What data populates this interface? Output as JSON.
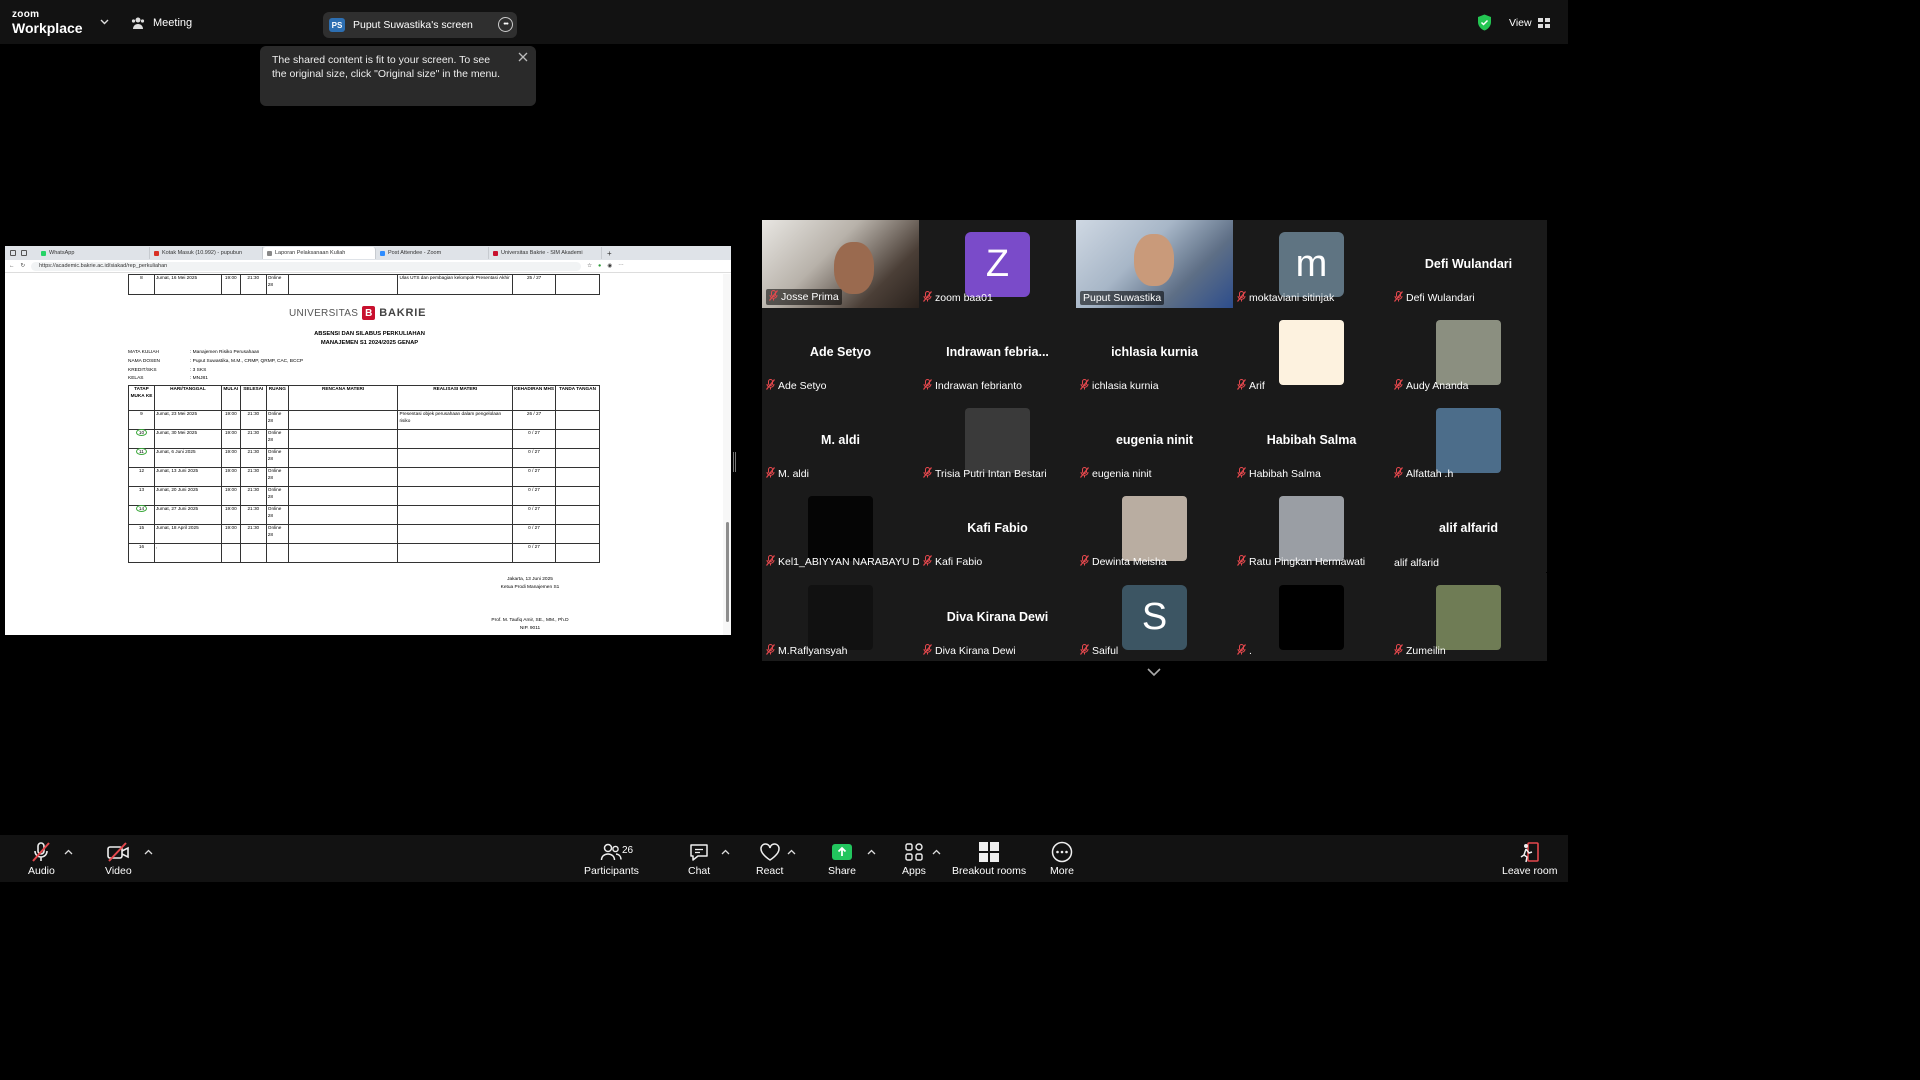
{
  "app": {
    "brand_line1": "zoom",
    "brand_line2": "Workplace",
    "meeting_label": "Meeting"
  },
  "share_pill": {
    "badge": "PS",
    "title": "Puput Suwastika's screen"
  },
  "view_label": "View",
  "tooltip": {
    "text": "The shared content is fit to your screen. To see the original size, click \"Original size\" in the menu."
  },
  "browser": {
    "tabs": [
      {
        "label": "WhatsApp",
        "color": "#25d366"
      },
      {
        "label": "Kotak Masuk (10.992) - pupubun",
        "color": "#d93025"
      },
      {
        "label": "Laporan Pelaksanaan Kuliah",
        "color": "#888888"
      },
      {
        "label": "Post Attendee - Zoom",
        "color": "#2d8cff"
      },
      {
        "label": "Universitas Bakrie - SIM Akademi",
        "color": "#c8102e"
      }
    ],
    "url": "https://academic.bakrie.ac.id/siakad/rep_perkuliahan"
  },
  "document": {
    "uni_left": "UNIVERSITAS",
    "uni_mark": "B",
    "uni_right": "BAKRIE",
    "title1": "ABSENSI DAN SILABUS PERKULIAHAN",
    "title2": "MANAJEMEN S1 2024/2025 GENAP",
    "meta": [
      {
        "k": "MATA KULIAH",
        "v": ": Manajemen Risiko Perusahaan"
      },
      {
        "k": "NAMA DOSEN",
        "v": ": Puput Suwastika, M.M., CRMP, QRMP, CAC, BCCP"
      },
      {
        "k": "KREDIT/SKS",
        "v": ": 3 SKS"
      },
      {
        "k": "KELAS",
        "v": ": MNJ81"
      }
    ],
    "prev_row": {
      "no": "8",
      "date": "Jumat, 16 Mei 2025",
      "start": "19:00",
      "end": "21:30",
      "room": "Online 28",
      "realisasi": "Ulas UTS dan pembagian kelompok Presentasi Akhir",
      "att": "25 / 27"
    },
    "headers": [
      "TATAP MUKA KE",
      "HARI/TANGGAL",
      "MULAI",
      "SELESAI",
      "RUANG",
      "RENCANA MATERI",
      "REALISASI MATERI",
      "KEHADIRAN MHS",
      "TANDA TANGAN"
    ],
    "rows": [
      {
        "no": "9",
        "date": "Jumat, 23 Mei 2025",
        "start": "19:00",
        "end": "21:30",
        "room": "Online 28",
        "realisasi": "Presentasi objek perusahaan dalam pengelolaan risiko",
        "att": "26 / 27"
      },
      {
        "no": "10",
        "date": "Jumat, 30 Mei 2025",
        "start": "19:00",
        "end": "21:30",
        "room": "Online 28",
        "realisasi": "",
        "att": "0 / 27"
      },
      {
        "no": "11",
        "date": "Jumat, 6 Juni 2025",
        "start": "19:00",
        "end": "21:30",
        "room": "Online 28",
        "realisasi": "",
        "att": "0 / 27"
      },
      {
        "no": "12",
        "date": "Jumat, 13 Juni 2025",
        "start": "19:00",
        "end": "21:30",
        "room": "Online 28",
        "realisasi": "",
        "att": "0 / 27"
      },
      {
        "no": "13",
        "date": "Jumat, 20 Juni 2025",
        "start": "19:00",
        "end": "21:30",
        "room": "Online 28",
        "realisasi": "",
        "att": "0 / 27"
      },
      {
        "no": "14",
        "date": "Jumat, 27 Juni 2025",
        "start": "19:00",
        "end": "21:30",
        "room": "Online 28",
        "realisasi": "",
        "att": "0 / 27"
      },
      {
        "no": "15",
        "date": "Jumat, 18 April 2025",
        "start": "19:00",
        "end": "21:30",
        "room": "Online 28",
        "realisasi": "",
        "att": "0 / 27"
      },
      {
        "no": "16",
        "date": ",",
        "start": "",
        "end": "",
        "room": "",
        "realisasi": "",
        "att": "0 / 27"
      }
    ],
    "sign_place": "Jakarta, 13 Juni 2025",
    "sign_role": "Ketua Prodi Manajemen S1",
    "sign_name": "Prof. M. Taufiq Amir, SE., MM., Ph.D",
    "sign_nip": "NIP. 9011"
  },
  "participants": [
    {
      "name": "Josse Prima",
      "type": "video",
      "muted": true
    },
    {
      "name": "zoom baa01",
      "type": "avatar",
      "letter": "Z",
      "color": "#7a4bc9",
      "muted": true
    },
    {
      "name": "Puput Suwastika",
      "type": "video",
      "muted": false,
      "speaking": true
    },
    {
      "name": "moktaviani sitinjak",
      "type": "avatar",
      "letter": "m",
      "color": "#5f7482",
      "muted": true
    },
    {
      "name": "Defi Wulandari",
      "type": "text",
      "muted": true
    },
    {
      "name": "Ade Setyo",
      "type": "text",
      "muted": true
    },
    {
      "name": "Indrawan febrianto",
      "display": "Indrawan  febria...",
      "type": "text",
      "muted": true
    },
    {
      "name": "ichlasia kurnia",
      "type": "text",
      "muted": true
    },
    {
      "name": "Arif",
      "type": "thumb",
      "color": "#fdf2df",
      "muted": true
    },
    {
      "name": "Audy Ananda",
      "type": "thumb",
      "color": "#8b8f80",
      "muted": true
    },
    {
      "name": "M. aldi",
      "type": "text",
      "muted": true
    },
    {
      "name": "Trisia Putri Intan Bestari",
      "type": "thumb",
      "color": "#3a3a3a",
      "muted": true
    },
    {
      "name": "eugenia ninit",
      "type": "text",
      "muted": true
    },
    {
      "name": "Habibah Salma",
      "type": "text",
      "muted": true
    },
    {
      "name": "Alfattah .h",
      "type": "thumb",
      "color": "#4c6d8a",
      "muted": true
    },
    {
      "name": "Kel1_ABIYYAN NARABAYU D",
      "type": "thumb",
      "color": "#050505",
      "muted": true
    },
    {
      "name": "Kafi Fabio",
      "type": "text",
      "muted": true
    },
    {
      "name": "Dewinta Meisha",
      "type": "thumb",
      "color": "#b9ada1",
      "muted": true
    },
    {
      "name": "Ratu Pingkan Hermawati",
      "type": "thumb",
      "color": "#9a9ea4",
      "muted": true
    },
    {
      "name": "alif alfarid",
      "type": "text",
      "muted": false
    },
    {
      "name": "M.Raflyansyah",
      "type": "thumb",
      "color": "#111111",
      "muted": true
    },
    {
      "name": "Diva Kirana Dewi",
      "type": "text",
      "muted": true
    },
    {
      "name": "Saiful",
      "type": "avatar",
      "letter": "S",
      "color": "#3c5563",
      "muted": true
    },
    {
      "name": ".",
      "type": "thumb",
      "color": "#000000",
      "muted": true
    },
    {
      "name": "Zumeilin",
      "type": "thumb",
      "color": "#6f7c55",
      "muted": true
    }
  ],
  "toolbar": {
    "audio": "Audio",
    "video": "Video",
    "participants": "Participants",
    "participants_count": "26",
    "chat": "Chat",
    "react": "React",
    "share": "Share",
    "apps": "Apps",
    "breakout": "Breakout rooms",
    "more": "More",
    "leave": "Leave room"
  },
  "colors": {
    "accent_green": "#23d959",
    "mute_red": "#e5484d",
    "share_green": "#22c55e"
  }
}
